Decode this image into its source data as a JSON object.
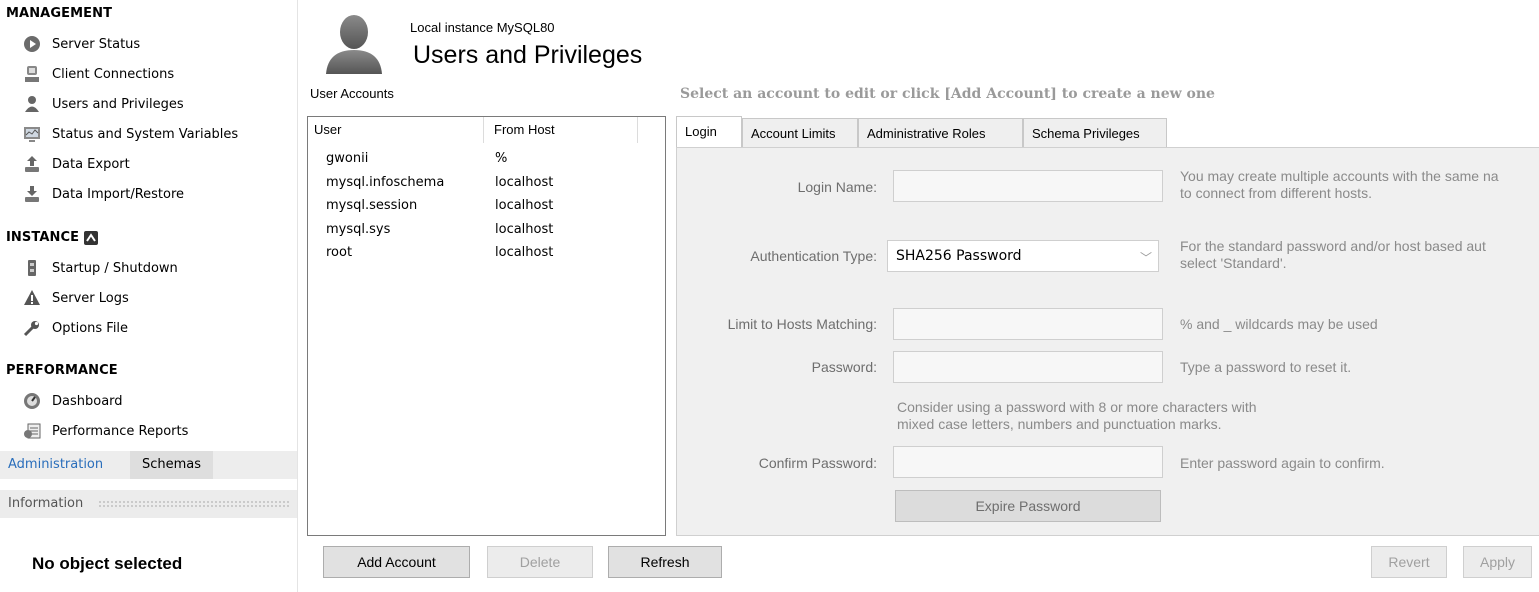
{
  "sidebar": {
    "management": {
      "heading": "MANAGEMENT",
      "items": [
        {
          "label": "Server Status",
          "icon": "server-status-icon"
        },
        {
          "label": "Client Connections",
          "icon": "client-connections-icon"
        },
        {
          "label": "Users and Privileges",
          "icon": "user-icon"
        },
        {
          "label": "Status and System Variables",
          "icon": "status-variables-icon"
        },
        {
          "label": "Data Export",
          "icon": "export-icon"
        },
        {
          "label": "Data Import/Restore",
          "icon": "import-icon"
        }
      ]
    },
    "instance": {
      "heading": "INSTANCE",
      "items": [
        {
          "label": "Startup / Shutdown",
          "icon": "startup-icon"
        },
        {
          "label": "Server Logs",
          "icon": "warning-icon"
        },
        {
          "label": "Options File",
          "icon": "wrench-icon"
        }
      ]
    },
    "performance": {
      "heading": "PERFORMANCE",
      "items": [
        {
          "label": "Dashboard",
          "icon": "dashboard-icon"
        },
        {
          "label": "Performance Reports",
          "icon": "reports-icon"
        }
      ]
    },
    "tabs": {
      "administration": "Administration",
      "schemas": "Schemas"
    },
    "information": "Information",
    "no_object": "No object selected"
  },
  "header": {
    "subtitle": "Local instance MySQL80",
    "title": "Users and Privileges"
  },
  "accounts": {
    "label": "User Accounts",
    "columns": [
      "User",
      "From Host"
    ],
    "rows": [
      {
        "user": "gwonii",
        "host": "%"
      },
      {
        "user": "mysql.infoschema",
        "host": "localhost"
      },
      {
        "user": "mysql.session",
        "host": "localhost"
      },
      {
        "user": "mysql.sys",
        "host": "localhost"
      },
      {
        "user": "root",
        "host": "localhost"
      }
    ]
  },
  "editor": {
    "hint": "Select an account to edit or click [Add Account] to create a new one",
    "tabs": [
      "Login",
      "Account Limits",
      "Administrative Roles",
      "Schema Privileges"
    ],
    "active_tab": "Login",
    "login_name": {
      "label": "Login Name:",
      "value": "",
      "help1": "You may create multiple accounts with the same na",
      "help2": "to connect from different hosts."
    },
    "auth_type": {
      "label": "Authentication Type:",
      "value": "SHA256 Password",
      "help1": "For the standard password and/or host based aut",
      "help2": "select 'Standard'."
    },
    "hosts": {
      "label": "Limit to Hosts Matching:",
      "value": "",
      "help": "% and _ wildcards may be used"
    },
    "password": {
      "label": "Password:",
      "value": "",
      "help": "Type a password to reset it."
    },
    "pw_advice1": "Consider using a password with 8 or more characters with",
    "pw_advice2": "mixed case letters, numbers and punctuation marks.",
    "confirm": {
      "label": "Confirm Password:",
      "value": "",
      "help": "Enter password again to confirm."
    },
    "expire_button": "Expire Password"
  },
  "buttons": {
    "add": "Add Account",
    "delete": "Delete",
    "refresh": "Refresh",
    "revert": "Revert",
    "apply": "Apply"
  },
  "colors": {
    "accent": "#2a6ebb",
    "panel_bg": "#f0f0f0"
  }
}
